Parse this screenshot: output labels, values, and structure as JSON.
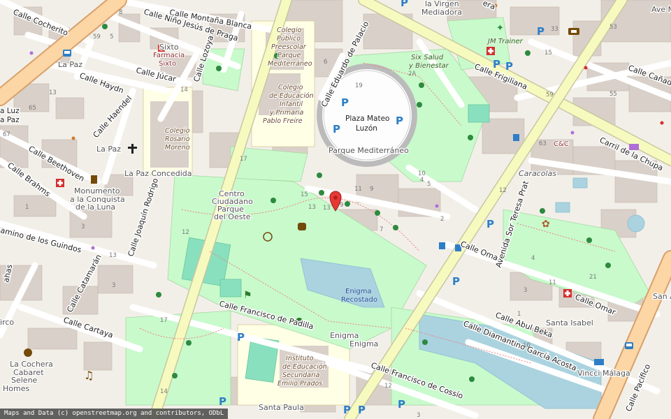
{
  "map": {
    "streets": {
      "cocherito": "Calle Cocherito",
      "montana": "Calle Montaña Blanca",
      "nino": "Calle Niño Jesús de Praga",
      "jucar": "Calle Júcar",
      "lozoya": "Calle Lozoya",
      "haydn": "Calle Haydn",
      "haendel": "Calle Haendel",
      "beethoven": "Calle Beethoven",
      "brahms": "Calle Brahms",
      "guindos": "amino de los Guindos",
      "mahas": "ahas",
      "joaquin": "Calle Joaquín Rodrigo",
      "catamaran": "Calle Catamarán",
      "cartaya": "Calle Cartaya",
      "padilla": "Calle Francisco de Padilla",
      "cossio": "Calle Francisco de Cossío",
      "eduardo": "Calle Eduardo de Palacio",
      "frigiliana": "Calle Frigiliana",
      "canada": "Calle Cañada",
      "chupa": "Carril de la Chupa",
      "omar1": "Calle Omar",
      "omar2": "Calle Omar",
      "teresa": "Avenida Sor Teresa Prat",
      "beka": "Calle Abul Beka",
      "diamantino": "Calle Diamantino García Acosta",
      "pacifico": "Calle Pacífico",
      "vera": "era"
    },
    "places": {
      "sixto": "Sixto",
      "lapaz": "La Paz",
      "lapaz_concedida": "La Paz Concedida",
      "santa_isabel": "Santa Isabel",
      "santa_paula": "Santa Paula",
      "parque_med": "Parque Mediterráneo",
      "plaza_1": "Plaza Mateo",
      "plaza_2": "Luzón",
      "ave_m": "Ave M",
      "san_a": "San A",
      "enigma1": "Enigma",
      "enigma2": "Enigma",
      "enigma_rec_1": "Enigma",
      "enigma_rec_2": "Recostado",
      "la_luz_1": "a Luz",
      "la_luz_2": "a Paz",
      "irco": "irco"
    },
    "pois": {
      "farmacia_1": "Farmacia",
      "farmacia_2": "Sixto",
      "la_virgen": "la Virgen",
      "mediadora": "Mediadora",
      "jm_trainer": "JM Trainer",
      "six_salud_1": "Six Salud",
      "six_salud_2": "y Bienestar",
      "cnc": "C&C",
      "caracolas": "Caracolas",
      "vincci": "Vincci Málaga",
      "la_paz_bus": "La Paz",
      "monumento_1": "Monumento",
      "monumento_2": "a la Conquista",
      "monumento_3": "de la Luna",
      "centro_1": "Centro",
      "centro_2": "Ciudadano",
      "centro_3": "Parque",
      "centro_4": "del Oeste",
      "cochera_1": "La Cochera",
      "cochera_2": "Cabaret",
      "selene_1": "Selene",
      "selene_2": "Homes"
    },
    "schools": {
      "preescolar": [
        "Colegio",
        "Público",
        "Preescolar",
        "Parque",
        "Mediterráneo"
      ],
      "pablo_freire": [
        "Colegio",
        "de Educación",
        "Infantil",
        "y Primaria",
        "Pablo Freire"
      ],
      "rosario": [
        "Colegio",
        "Rosario",
        "Moreno"
      ],
      "instituto": [
        "Instituto",
        "de Educación",
        "Secundaria",
        "Emilio Prados"
      ]
    },
    "house_numbers": [
      "59",
      "8",
      "5",
      "13",
      "65",
      "67",
      "1",
      "3",
      "13",
      "3",
      "17",
      "6",
      "14",
      "12",
      "19",
      "9",
      "15",
      "13",
      "11",
      "9",
      "2A",
      "33",
      "15",
      "59",
      "63",
      "55",
      "53",
      "21",
      "17",
      "14",
      "12",
      "3",
      "10",
      "4",
      "2",
      "7",
      "5",
      "13",
      "12",
      "11",
      "4",
      "1",
      "3",
      "10"
    ],
    "colors": {
      "background": "#f2efe9",
      "building": "#d9d0c9",
      "park": "#c8facc",
      "water": "#aad3df",
      "primary_road": "#fcd6a4",
      "secondary_road": "#f7fabf",
      "pitch": "#88e0be",
      "school_area": "#ffffe5",
      "marker": "#e53935"
    }
  },
  "attribution": "Maps and Data (c) openstreetmap.org and contributors, ODbL"
}
